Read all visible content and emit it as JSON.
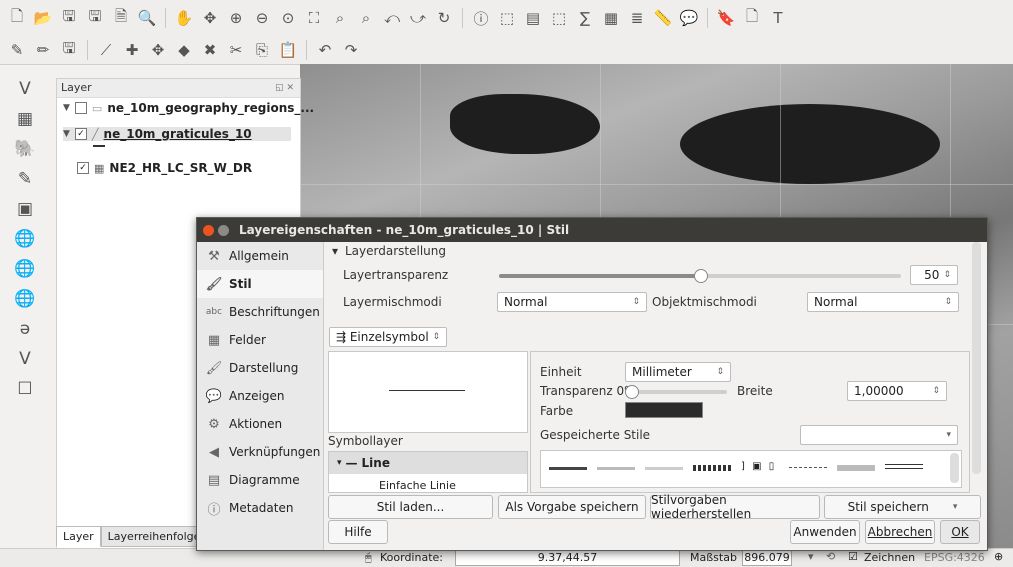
{
  "toolbar1_icons": [
    "new-project-icon",
    "open-project-icon",
    "save-project-icon",
    "save-as-icon",
    "new-print-layout-icon",
    "layout-manager-icon",
    "pan-icon",
    "pan-to-selection-icon",
    "zoom-in-icon",
    "zoom-out-icon",
    "zoom-native-icon",
    "zoom-full-icon",
    "zoom-to-selection-icon",
    "zoom-to-layer-icon",
    "zoom-last-icon",
    "zoom-next-icon",
    "refresh-icon",
    "identify-icon",
    "select-features-icon",
    "select-by-value-icon",
    "deselect-icon",
    "field-calculator-icon",
    "attribute-table-icon",
    "statistics-icon",
    "measure-icon",
    "map-tips-icon",
    "bookmark-icon",
    "new-bookmark-icon",
    "text-annotation-icon"
  ],
  "toolbar2_icons": [
    "current-edits-icon",
    "toggle-editing-icon",
    "save-edits-icon",
    "digitize-icon",
    "add-feature-icon",
    "move-feature-icon",
    "node-tool-icon",
    "delete-selected-icon",
    "cut-features-icon",
    "copy-features-icon",
    "paste-features-icon",
    "undo-icon",
    "redo-icon"
  ],
  "left_tools": [
    "add-vector-layer-icon",
    "add-raster-layer-icon",
    "add-postgis-layer-icon",
    "add-spatialite-layer-icon",
    "add-mssql-layer-icon",
    "add-wms-layer-icon",
    "add-wcs-layer-icon",
    "add-wfs-layer-icon",
    "add-delimited-text-icon",
    "new-shapefile-icon",
    "new-temp-layer-icon"
  ],
  "layer_panel": {
    "title": "Layer",
    "layers": [
      {
        "name": "ne_10m_geography_regions_...",
        "checked": false,
        "expanded": true
      },
      {
        "name": "ne_10m_graticules_10",
        "checked": true,
        "expanded": true
      },
      {
        "name": "NE2_HR_LC_SR_W_DR",
        "checked": true,
        "expanded": false
      }
    ],
    "tabs": [
      "Layer",
      "Layerreihenfolge"
    ]
  },
  "dialog": {
    "title": "Layereigenschaften - ne_10m_graticules_10 | Stil",
    "sidebar": [
      "Allgemein",
      "Stil",
      "Beschriftungen",
      "Felder",
      "Darstellung",
      "Anzeigen",
      "Aktionen",
      "Verknüpfungen",
      "Diagramme",
      "Metadaten"
    ],
    "active_item": "Stil",
    "section_title": "Layerdarstellung",
    "layer_transparency_label": "Layertransparenz",
    "layer_transparency_value": "50",
    "layer_transparency_fraction": 0.5,
    "blend_mode_label": "Layermischmodi",
    "blend_mode_value": "Normal",
    "feature_blend_label": "Objektmischmodi",
    "feature_blend_value": "Normal",
    "renderer_value": "Einzelsymbol",
    "symbol_layer_label": "Symbollayer",
    "symbol_tree_root": "Line",
    "symbol_tree_child": "Einfache Linie",
    "unit_label": "Einheit",
    "unit_value": "Millimeter",
    "transparency_label": "Transparenz 0%",
    "width_label": "Breite",
    "width_value": "1,00000",
    "color_label": "Farbe",
    "color_value": "#2b2b2b",
    "saved_styles_label": "Gespeicherte Stile",
    "style_buttons": {
      "load": "Stil laden...",
      "save_default": "Als Vorgabe speichern",
      "restore_default": "Stilvorgaben wiederherstellen",
      "save_style": "Stil speichern"
    },
    "bottom_buttons": {
      "help": "Hilfe",
      "apply": "Anwenden",
      "cancel": "Abbrechen",
      "ok": "OK"
    }
  },
  "statusbar": {
    "coordinate_label": "Koordinate:",
    "coordinate_value": "9.37,44.57",
    "scale_label": "Maßstab",
    "scale_value": "896.079",
    "render_label": "Zeichnen",
    "crs": "EPSG:4326"
  }
}
